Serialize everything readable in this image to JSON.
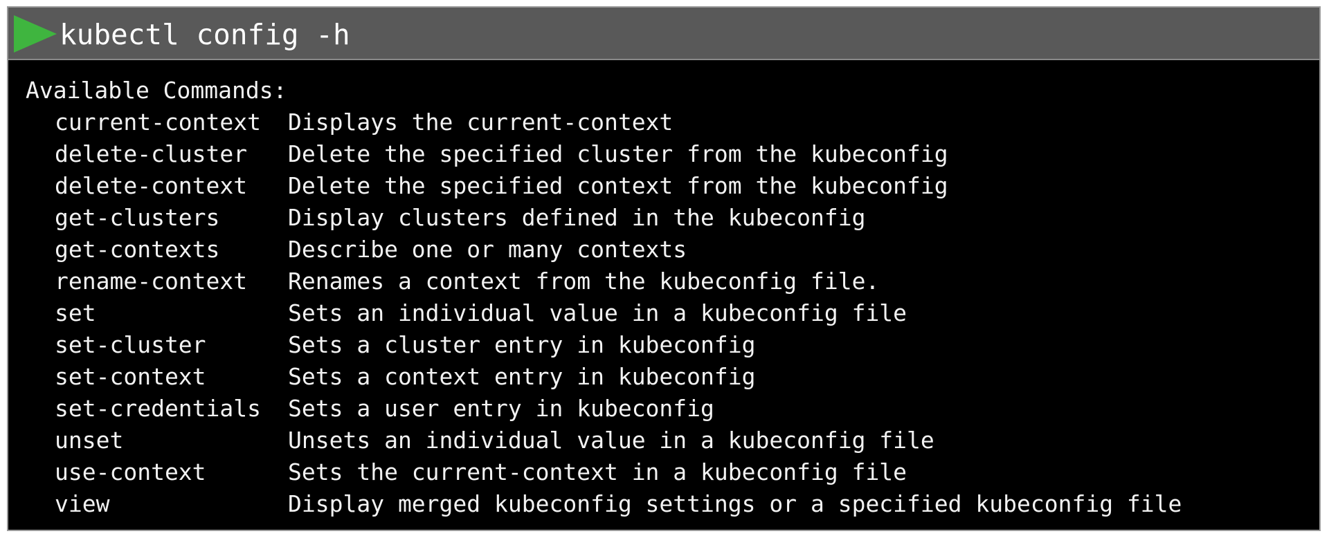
{
  "terminal": {
    "command": "kubectl config -h",
    "play_icon": "play-triangle-icon",
    "play_icon_color": "#3fb53f",
    "heading": "Available Commands:",
    "commands": [
      {
        "name": "current-context",
        "description": "Displays the current-context"
      },
      {
        "name": "delete-cluster",
        "description": "Delete the specified cluster from the kubeconfig"
      },
      {
        "name": "delete-context",
        "description": "Delete the specified context from the kubeconfig"
      },
      {
        "name": "get-clusters",
        "description": "Display clusters defined in the kubeconfig"
      },
      {
        "name": "get-contexts",
        "description": "Describe one or many contexts"
      },
      {
        "name": "rename-context",
        "description": "Renames a context from the kubeconfig file."
      },
      {
        "name": "set",
        "description": "Sets an individual value in a kubeconfig file"
      },
      {
        "name": "set-cluster",
        "description": "Sets a cluster entry in kubeconfig"
      },
      {
        "name": "set-context",
        "description": "Sets a context entry in kubeconfig"
      },
      {
        "name": "set-credentials",
        "description": "Sets a user entry in kubeconfig"
      },
      {
        "name": "unset",
        "description": "Unsets an individual value in a kubeconfig file"
      },
      {
        "name": "use-context",
        "description": "Sets the current-context in a kubeconfig file"
      },
      {
        "name": "view",
        "description": "Display merged kubeconfig settings or a specified kubeconfig file"
      }
    ]
  }
}
